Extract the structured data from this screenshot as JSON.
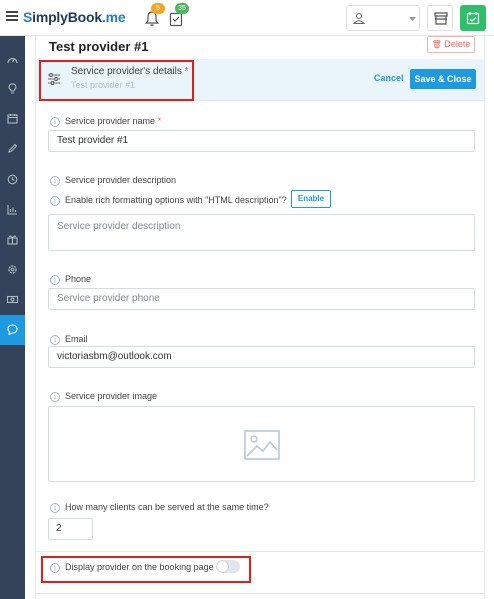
{
  "header": {
    "logo": {
      "s": "S",
      "book": "implyBook",
      "me": ".me"
    },
    "notifications_badge": "5",
    "calendar_badge": "35",
    "icons": [
      "menu-icon",
      "bell-icon",
      "clipboard-icon",
      "user-icon",
      "chevron-down-icon",
      "store-icon",
      "calendar-icon"
    ]
  },
  "sidebar": {
    "items": [
      "dashboard-icon",
      "lightbulb-icon",
      "calendar-icon",
      "pencil-icon",
      "clock-icon",
      "chart-icon",
      "gift-icon",
      "gear-icon",
      "cash-icon",
      "chat-icon"
    ],
    "active_index": 9
  },
  "page": {
    "title": "Test provider #1",
    "delete_label": "Delete"
  },
  "details": {
    "title": "Service provider's details",
    "required_mark": "*",
    "subtitle": "Test provider #1",
    "cancel_label": "Cancel",
    "save_label": "Save & Close"
  },
  "form": {
    "name_label": "Service provider name",
    "name_required": "*",
    "name_value": "Test provider #1",
    "description_label": "Service provider description",
    "rich_label": "Enable rich formatting options with \"HTML description\"?",
    "enable_label": "Enable",
    "description_placeholder": "Service provider description",
    "phone_label": "Phone",
    "phone_placeholder": "Service provider phone",
    "email_label": "Email",
    "email_value": "victoriasbm@outlook.com",
    "image_label": "Service provider image",
    "clients_label": "How many clients can be served at the same time?",
    "clients_value": "2",
    "display_label": "Display provider on the booking page",
    "display_enabled": false
  },
  "colors": {
    "accent": "#1e9ae0",
    "sidebar": "#34435a",
    "highlight": "#e0201b",
    "brand_green": "#2fbf6b"
  }
}
